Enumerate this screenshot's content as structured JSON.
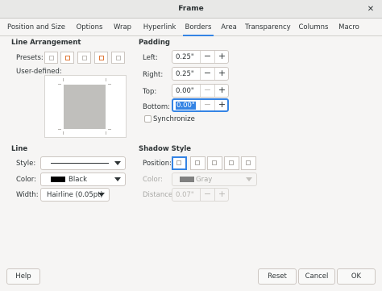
{
  "window": {
    "title": "Frame"
  },
  "tabs": [
    {
      "label": "Position and Size"
    },
    {
      "label": "Options"
    },
    {
      "label": "Wrap"
    },
    {
      "label": "Hyperlink"
    },
    {
      "label": "Borders",
      "active": true
    },
    {
      "label": "Area"
    },
    {
      "label": "Transparency"
    },
    {
      "label": "Columns"
    },
    {
      "label": "Macro"
    }
  ],
  "line_arrangement": {
    "title": "Line Arrangement",
    "presets_label": "Presets:",
    "user_defined_label": "User-defined:"
  },
  "padding": {
    "title": "Padding",
    "left": {
      "label": "Left:",
      "value": "0.25\""
    },
    "right": {
      "label": "Right:",
      "value": "0.25\""
    },
    "top": {
      "label": "Top:",
      "value": "0.00\""
    },
    "bottom": {
      "label": "Bottom:",
      "value": "0.00\""
    },
    "synchronize_label": "Synchronize"
  },
  "line": {
    "title": "Line",
    "style_label": "Style:",
    "color_label": "Color:",
    "color_value": "Black",
    "width_label": "Width:",
    "width_value": "Hairline (0.05pt)"
  },
  "shadow_style": {
    "title": "Shadow Style",
    "position_label": "Position:",
    "color_label": "Color:",
    "color_value": "Gray",
    "distance_label": "Distance:",
    "distance_value": "0.07\""
  },
  "buttons": {
    "help": "Help",
    "reset": "Reset",
    "cancel": "Cancel",
    "ok": "OK"
  },
  "colors": {
    "accent": "#3584e4",
    "black_swatch": "#000000",
    "gray_swatch": "#808080"
  }
}
